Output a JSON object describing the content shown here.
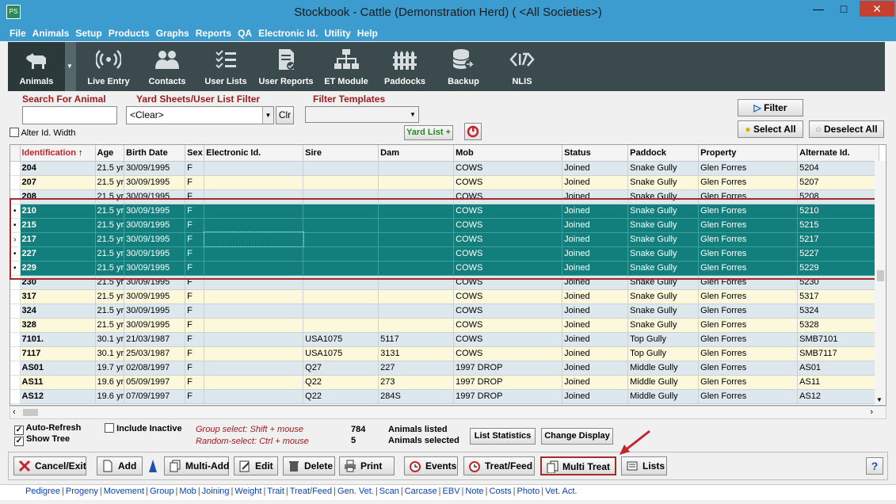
{
  "window": {
    "title": "Stockbook - Cattle (Demonstration Herd) ( <All Societies>)",
    "app_icon": "PS"
  },
  "menu": [
    "File",
    "Animals",
    "Setup",
    "Products",
    "Graphs",
    "Reports",
    "QA",
    "Electronic Id.",
    "Utility",
    "Help"
  ],
  "toolbar": [
    {
      "label": "Animals",
      "icon": "cow-icon"
    },
    {
      "label": "Live Entry",
      "icon": "broadcast-icon"
    },
    {
      "label": "Contacts",
      "icon": "people-icon"
    },
    {
      "label": "User Lists",
      "icon": "checklist-icon"
    },
    {
      "label": "User Reports",
      "icon": "report-icon"
    },
    {
      "label": "ET Module",
      "icon": "hierarchy-icon"
    },
    {
      "label": "Paddocks",
      "icon": "fence-icon"
    },
    {
      "label": "Backup",
      "icon": "database-icon"
    },
    {
      "label": "NLIS",
      "icon": "nlis-icon"
    }
  ],
  "filters": {
    "search_label": "Search For Animal",
    "search_value": "",
    "yard_label": "Yard Sheets/User List Filter",
    "yard_value": "<Clear>",
    "clr": "Clr",
    "templates_label": "Filter Templates",
    "templates_value": "",
    "alter_id": "Alter Id. Width",
    "yard_list": "Yard List +",
    "filter_btn": "Filter",
    "select_all": "Select All",
    "deselect_all": "Deselect All"
  },
  "grid": {
    "columns": [
      "Identification",
      "Age",
      "Birth Date",
      "Sex",
      "Electronic Id.",
      "Sire",
      "Dam",
      "Mob",
      "Status",
      "Paddock",
      "Property",
      "Alternate Id."
    ],
    "sort_indicator": "↑",
    "rows": [
      {
        "mark": "",
        "sel": false,
        "c": [
          "204",
          "21.5 yr",
          "30/09/1995",
          "F",
          "",
          "",
          "",
          "COWS",
          "Joined",
          "Snake Gully",
          "Glen Forres",
          "5204"
        ]
      },
      {
        "mark": "",
        "sel": false,
        "c": [
          "207",
          "21.5 yr",
          "30/09/1995",
          "F",
          "",
          "",
          "",
          "COWS",
          "Joined",
          "Snake Gully",
          "Glen Forres",
          "5207"
        ]
      },
      {
        "mark": "",
        "sel": false,
        "c": [
          "208",
          "21.5 yr",
          "30/09/1995",
          "F",
          "",
          "",
          "",
          "COWS",
          "Joined",
          "Snake Gully",
          "Glen Forres",
          "5208"
        ]
      },
      {
        "mark": "•",
        "sel": true,
        "c": [
          "210",
          "21.5 yr",
          "30/09/1995",
          "F",
          "",
          "",
          "",
          "COWS",
          "Joined",
          "Snake Gully",
          "Glen Forres",
          "5210"
        ]
      },
      {
        "mark": "•",
        "sel": true,
        "c": [
          "215",
          "21.5 yr",
          "30/09/1995",
          "F",
          "",
          "",
          "",
          "COWS",
          "Joined",
          "Snake Gully",
          "Glen Forres",
          "5215"
        ]
      },
      {
        "mark": "›",
        "sel": true,
        "c": [
          "217",
          "21.5 yr",
          "30/09/1995",
          "F",
          "",
          "",
          "",
          "COWS",
          "Joined",
          "Snake Gully",
          "Glen Forres",
          "5217"
        ]
      },
      {
        "mark": "•",
        "sel": true,
        "c": [
          "227",
          "21.5 yr",
          "30/09/1995",
          "F",
          "",
          "",
          "",
          "COWS",
          "Joined",
          "Snake Gully",
          "Glen Forres",
          "5227"
        ]
      },
      {
        "mark": "•",
        "sel": true,
        "c": [
          "229",
          "21.5 yr",
          "30/09/1995",
          "F",
          "",
          "",
          "",
          "COWS",
          "Joined",
          "Snake Gully",
          "Glen Forres",
          "5229"
        ]
      },
      {
        "mark": "",
        "sel": false,
        "c": [
          "230",
          "21.5 yr",
          "30/09/1995",
          "F",
          "",
          "",
          "",
          "COWS",
          "Joined",
          "Snake Gully",
          "Glen Forres",
          "5230"
        ]
      },
      {
        "mark": "",
        "sel": false,
        "c": [
          "317",
          "21.5 yr",
          "30/09/1995",
          "F",
          "",
          "",
          "",
          "COWS",
          "Joined",
          "Snake Gully",
          "Glen Forres",
          "5317"
        ]
      },
      {
        "mark": "",
        "sel": false,
        "c": [
          "324",
          "21.5 yr",
          "30/09/1995",
          "F",
          "",
          "",
          "",
          "COWS",
          "Joined",
          "Snake Gully",
          "Glen Forres",
          "5324"
        ]
      },
      {
        "mark": "",
        "sel": false,
        "c": [
          "328",
          "21.5 yr",
          "30/09/1995",
          "F",
          "",
          "",
          "",
          "COWS",
          "Joined",
          "Snake Gully",
          "Glen Forres",
          "5328"
        ]
      },
      {
        "mark": "",
        "sel": false,
        "c": [
          "7101.",
          "30.1 yr",
          "21/03/1987",
          "F",
          "",
          "USA1075",
          "5117",
          "COWS",
          "Joined",
          "Top Gully",
          "Glen Forres",
          "SMB7101"
        ]
      },
      {
        "mark": "",
        "sel": false,
        "c": [
          "7117",
          "30.1 yr",
          "25/03/1987",
          "F",
          "",
          "USA1075",
          "3131",
          "COWS",
          "Joined",
          "Top Gully",
          "Glen Forres",
          "SMB7117"
        ]
      },
      {
        "mark": "",
        "sel": false,
        "c": [
          "AS01",
          "19.7 yr",
          "02/08/1997",
          "F",
          "",
          "Q27",
          "227",
          "1997 DROP",
          "Joined",
          "Middle Gully",
          "Glen Forres",
          "AS01"
        ]
      },
      {
        "mark": "",
        "sel": false,
        "c": [
          "AS11",
          "19.6 yr",
          "05/09/1997",
          "F",
          "",
          "Q22",
          "273",
          "1997 DROP",
          "Joined",
          "Middle Gully",
          "Glen Forres",
          "AS11"
        ]
      },
      {
        "mark": "",
        "sel": false,
        "c": [
          "AS12",
          "19.6 yr",
          "07/09/1997",
          "F",
          "",
          "Q22",
          "284S",
          "1997 DROP",
          "Joined",
          "Middle Gully",
          "Glen Forres",
          "AS12"
        ]
      }
    ]
  },
  "status": {
    "auto_refresh": "Auto-Refresh",
    "show_tree": "Show Tree",
    "include_inactive": "Include Inactive",
    "hint1": "Group select: Shift + mouse",
    "hint2": "Random-select: Ctrl + mouse",
    "listed_count": "784",
    "selected_count": "5",
    "listed_label": "Animals listed",
    "selected_label": "Animals selected",
    "list_stats": "List Statistics",
    "change_display": "Change Display"
  },
  "buttons": {
    "cancel": "Cancel/Exit",
    "add": "Add",
    "multi_add": "Multi-Add",
    "edit": "Edit",
    "delete": "Delete",
    "print": "Print",
    "events": "Events",
    "treat_feed": "Treat/Feed",
    "multi_treat": "Multi Treat",
    "lists": "Lists",
    "help": "?"
  },
  "links": [
    "Pedigree",
    "Progeny",
    "Movement",
    "Group",
    "Mob",
    "Joining",
    "Weight",
    "Trait",
    "Treat/Feed",
    "Gen. Vet.",
    "Scan",
    "Carcase",
    "EBV",
    "Note",
    "Costs",
    "Photo",
    "Vet. Act."
  ],
  "colors": {
    "selected_row": "#127f7c",
    "odd_row": "#dde7ee",
    "even_row": "#fbf8dc",
    "highlight": "#a52a2a",
    "title_bar": "#3d9ccf"
  }
}
